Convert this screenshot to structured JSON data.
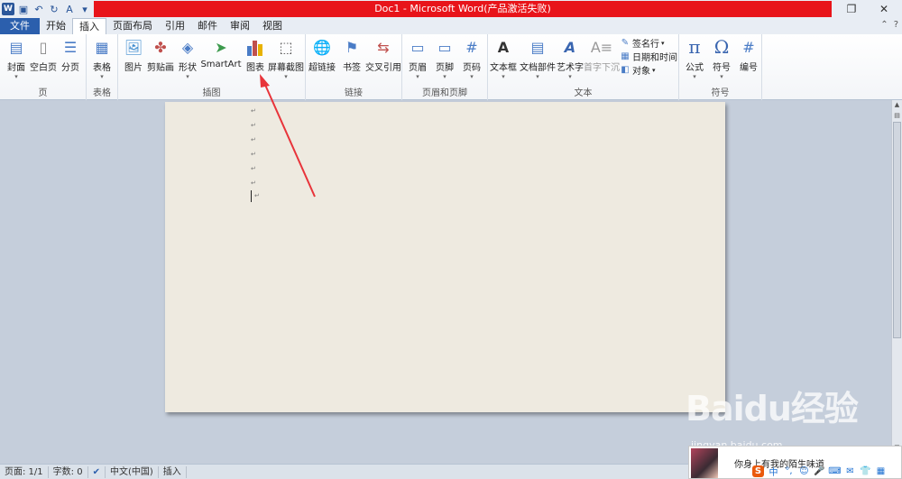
{
  "window": {
    "title": "Doc1 - Microsoft Word(产品激活失败)",
    "title_bar_color": "#e8141a",
    "controls": [
      "restore-icon",
      "close-icon"
    ]
  },
  "quick_access": [
    "word-icon",
    "save-icon",
    "undo-icon",
    "redo-icon",
    "format-painter-icon",
    "customize-icon"
  ],
  "tabs": [
    {
      "label": "文件",
      "active": false
    },
    {
      "label": "开始",
      "active": false
    },
    {
      "label": "插入",
      "active": true
    },
    {
      "label": "页面布局",
      "active": false
    },
    {
      "label": "引用",
      "active": false
    },
    {
      "label": "邮件",
      "active": false
    },
    {
      "label": "审阅",
      "active": false
    },
    {
      "label": "视图",
      "active": false
    }
  ],
  "ribbon": {
    "groups": [
      {
        "label": "页",
        "buttons": [
          "封面",
          "空白页",
          "分页"
        ]
      },
      {
        "label": "表格",
        "buttons": [
          "表格"
        ]
      },
      {
        "label": "插图",
        "buttons": [
          "图片",
          "剪贴画",
          "形状",
          "SmartArt",
          "图表",
          "屏幕截图"
        ]
      },
      {
        "label": "链接",
        "buttons": [
          "超链接",
          "书签",
          "交叉引用"
        ]
      },
      {
        "label": "页眉和页脚",
        "buttons": [
          "页眉",
          "页脚",
          "页码"
        ]
      },
      {
        "label": "文本",
        "buttons": [
          "文本框",
          "文档部件",
          "艺术字",
          "首字下沉"
        ],
        "small_buttons": [
          "签名行",
          "日期和时间",
          "对象"
        ]
      },
      {
        "label": "符号",
        "buttons": [
          "公式",
          "符号",
          "编号"
        ]
      }
    ]
  },
  "document": {
    "paragraph_marks": [
      "↵",
      "↵",
      "↵",
      "↵",
      "↵",
      "↵",
      "↵"
    ]
  },
  "statusbar": {
    "page": "页面: 1/1",
    "words": "字数: 0",
    "language": "中文(中国)",
    "mode": "插入"
  },
  "overlay": {
    "watermark": "Baidu经验",
    "watermark_url": "jingyan.baidu.com",
    "ime_tip": "你身上有我的陌生味道",
    "ime_logo": "S",
    "ime_icons": [
      "中",
      "°,",
      "☺",
      "🎤",
      "⌨",
      "✉",
      "👕",
      "▦"
    ],
    "arrow_color": "#e8343a"
  }
}
